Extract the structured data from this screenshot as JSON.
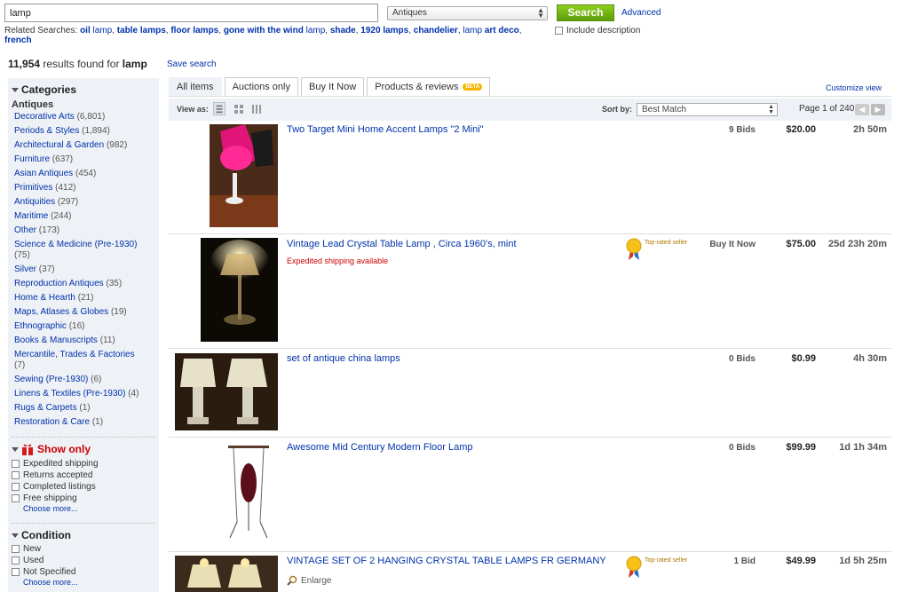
{
  "search": {
    "query": "lamp",
    "category": "Antiques",
    "button_label": "Search",
    "advanced_label": "Advanced",
    "related_label": "Related Searches:",
    "related": [
      {
        "bold": "oil",
        "rest": " lamp"
      },
      {
        "bold": "table lamps",
        "rest": ""
      },
      {
        "bold": "floor lamps",
        "rest": ""
      },
      {
        "bold": "gone with the wind",
        "rest": " lamp"
      },
      {
        "bold": "shade",
        "rest": ""
      },
      {
        "bold": "1920 lamps",
        "rest": ""
      },
      {
        "bold": "chandelier",
        "rest": ""
      },
      {
        "bold": "",
        "rest": "lamp "
      },
      {
        "bold": "art deco",
        "rest": ""
      },
      {
        "bold": "french",
        "rest": ""
      }
    ],
    "include_description_label": "Include description"
  },
  "results": {
    "count": "11,954",
    "found_for": "results found for",
    "keyword": "lamp",
    "save_search_label": "Save search"
  },
  "sidebar": {
    "categories_heading": "Categories",
    "parent_category": "Antiques",
    "categories": [
      {
        "name": "Decorative Arts",
        "count": "(6,801)"
      },
      {
        "name": "Periods & Styles",
        "count": "(1,894)"
      },
      {
        "name": "Architectural & Garden",
        "count": "(982)"
      },
      {
        "name": "Furniture",
        "count": "(637)"
      },
      {
        "name": "Asian Antiques",
        "count": "(454)"
      },
      {
        "name": "Primitives",
        "count": "(412)"
      },
      {
        "name": "Antiquities",
        "count": "(297)"
      },
      {
        "name": "Maritime",
        "count": "(244)"
      },
      {
        "name": "Other",
        "count": "(173)"
      },
      {
        "name": "Science & Medicine (Pre-1930)",
        "count": "(75)"
      },
      {
        "name": "Silver",
        "count": "(37)"
      },
      {
        "name": "Reproduction Antiques",
        "count": "(35)"
      },
      {
        "name": "Home & Hearth",
        "count": "(21)"
      },
      {
        "name": "Maps, Atlases & Globes",
        "count": "(19)"
      },
      {
        "name": "Ethnographic",
        "count": "(16)"
      },
      {
        "name": "Books & Manuscripts",
        "count": "(11)"
      },
      {
        "name": "Mercantile, Trades & Factories",
        "count": "(7)"
      },
      {
        "name": "Sewing (Pre-1930)",
        "count": "(6)"
      },
      {
        "name": "Linens & Textiles (Pre-1930)",
        "count": "(4)"
      },
      {
        "name": "Rugs & Carpets",
        "count": "(1)"
      },
      {
        "name": "Restoration & Care",
        "count": "(1)"
      }
    ],
    "show_only_heading": "Show only",
    "show_only": [
      "Expedited shipping",
      "Returns accepted",
      "Completed listings",
      "Free shipping"
    ],
    "choose_more": "Choose more...",
    "condition_heading": "Condition",
    "condition": [
      "New",
      "Used",
      "Not Specified"
    ],
    "condition_choose_more": "Choose more..."
  },
  "tabs": {
    "all": "All items",
    "auctions": "Auctions only",
    "bin": "Buy It Now",
    "products": "Products & reviews",
    "beta": "BETA",
    "customize": "Customize view"
  },
  "viewbar": {
    "view_as": "View as:",
    "sort_by": "Sort by:",
    "sort_value": "Best Match",
    "page_info": "Page 1 of 240"
  },
  "listings": [
    {
      "title": "Two Target Mini Home Accent Lamps \"2 Mini\"",
      "bids": "9 Bids",
      "price": "$20.00",
      "time": "2h 50m"
    },
    {
      "title": "Vintage Lead Crystal Table Lamp , Circa 1960's, mint",
      "shipping": "Expedited shipping available",
      "top_rated": "Top-rated seller",
      "bids": "Buy It Now",
      "price": "$75.00",
      "time": "25d 23h 20m"
    },
    {
      "title": "set of antique china lamps",
      "bids": "0 Bids",
      "price": "$0.99",
      "time": "4h 30m"
    },
    {
      "title": "Awesome Mid Century Modern Floor Lamp",
      "bids": "0 Bids",
      "price": "$99.99",
      "time": "1d 1h 34m"
    },
    {
      "title": "VINTAGE SET OF 2 HANGING CRYSTAL TABLE LAMPS FR GERMANY",
      "enlarge": "Enlarge",
      "top_rated": "Top-rated seller",
      "bids": "1 Bid",
      "price": "$49.99",
      "time": "1d 5h 25m"
    }
  ],
  "colors": {
    "link": "#0033aa",
    "search_button": "#6fb214",
    "sidebar_bg": "#eef1f6",
    "expedited": "#cc0000"
  }
}
